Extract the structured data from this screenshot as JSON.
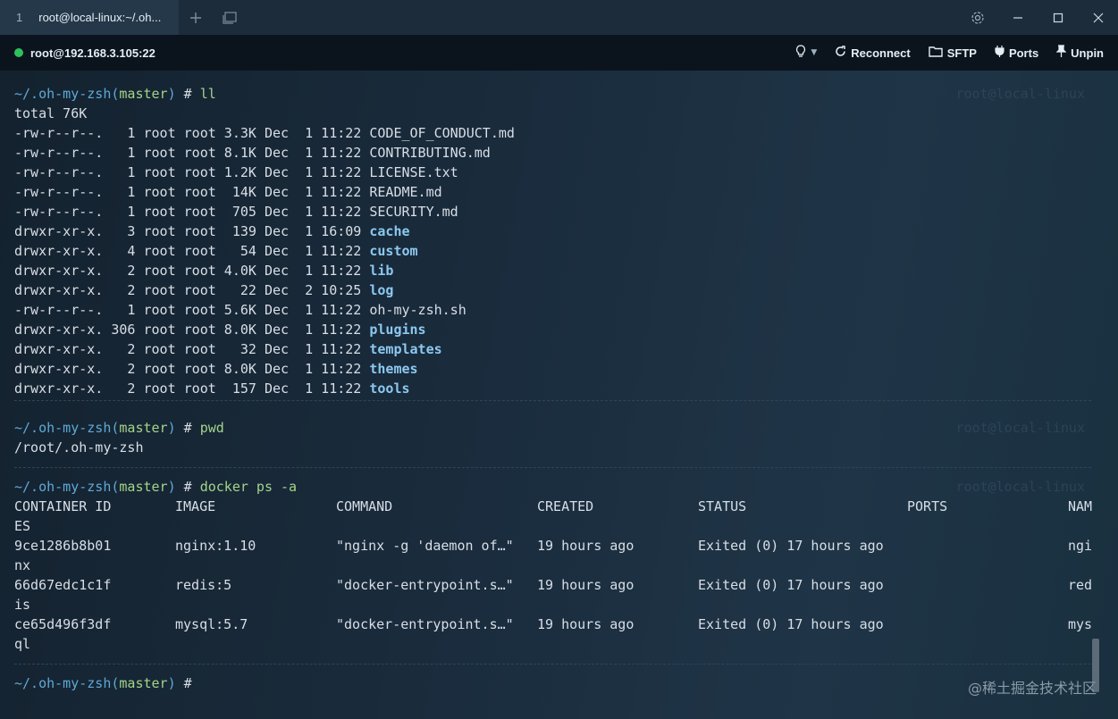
{
  "titlebar": {
    "tab_number": "1",
    "tab_title": "root@local-linux:~/.oh...",
    "new_tab_icon": "plus-icon",
    "tabs_icon": "windows-icon",
    "settings_icon": "gear-icon",
    "minimize_icon": "minimize-icon",
    "maximize_icon": "maximize-icon",
    "close_icon": "close-icon"
  },
  "session": {
    "status_color": "#2fbf5b",
    "host": "root@192.168.3.105:22",
    "hint_icon": "lightbulb-icon",
    "reconnect_label": "Reconnect",
    "sftp_label": "SFTP",
    "ports_label": "Ports",
    "unpin_label": "Unpin"
  },
  "terminal": {
    "host_marker": "root@local-linux",
    "prompt_path": "~/.oh-my-zsh",
    "prompt_branch_open": "(",
    "prompt_branch": "master",
    "prompt_branch_close": ")",
    "prompt_hash": " # ",
    "block1": {
      "command": "ll",
      "total": "total 76K",
      "rows": [
        {
          "meta": "-rw-r--r--.   1 root root 3.3K Dec  1 11:22 ",
          "name": "CODE_OF_CONDUCT.md",
          "dir": false
        },
        {
          "meta": "-rw-r--r--.   1 root root 8.1K Dec  1 11:22 ",
          "name": "CONTRIBUTING.md",
          "dir": false
        },
        {
          "meta": "-rw-r--r--.   1 root root 1.2K Dec  1 11:22 ",
          "name": "LICENSE.txt",
          "dir": false
        },
        {
          "meta": "-rw-r--r--.   1 root root  14K Dec  1 11:22 ",
          "name": "README.md",
          "dir": false
        },
        {
          "meta": "-rw-r--r--.   1 root root  705 Dec  1 11:22 ",
          "name": "SECURITY.md",
          "dir": false
        },
        {
          "meta": "drwxr-xr-x.   3 root root  139 Dec  1 16:09 ",
          "name": "cache",
          "dir": true
        },
        {
          "meta": "drwxr-xr-x.   4 root root   54 Dec  1 11:22 ",
          "name": "custom",
          "dir": true
        },
        {
          "meta": "drwxr-xr-x.   2 root root 4.0K Dec  1 11:22 ",
          "name": "lib",
          "dir": true
        },
        {
          "meta": "drwxr-xr-x.   2 root root   22 Dec  2 10:25 ",
          "name": "log",
          "dir": true
        },
        {
          "meta": "-rw-r--r--.   1 root root 5.6K Dec  1 11:22 ",
          "name": "oh-my-zsh.sh",
          "dir": false
        },
        {
          "meta": "drwxr-xr-x. 306 root root 8.0K Dec  1 11:22 ",
          "name": "plugins",
          "dir": true
        },
        {
          "meta": "drwxr-xr-x.   2 root root   32 Dec  1 11:22 ",
          "name": "templates",
          "dir": true
        },
        {
          "meta": "drwxr-xr-x.   2 root root 8.0K Dec  1 11:22 ",
          "name": "themes",
          "dir": true
        },
        {
          "meta": "drwxr-xr-x.   2 root root  157 Dec  1 11:22 ",
          "name": "tools",
          "dir": true
        }
      ]
    },
    "block2": {
      "command": "pwd",
      "output": "/root/.oh-my-zsh"
    },
    "block3": {
      "command": "docker ps -a",
      "headers": [
        "CONTAINER ID",
        "IMAGE",
        "COMMAND",
        "CREATED",
        "STATUS",
        "PORTS",
        "NAM"
      ],
      "header_wrap": "ES",
      "rows": [
        {
          "id": "9ce1286b8b01",
          "image": "nginx:1.10",
          "command": "\"nginx -g 'daemon of…\"",
          "created": "19 hours ago",
          "status": "Exited (0) 17 hours ago",
          "ports": "",
          "name": "ngi",
          "name_wrap": "nx"
        },
        {
          "id": "66d67edc1c1f",
          "image": "redis:5",
          "command": "\"docker-entrypoint.s…\"",
          "created": "19 hours ago",
          "status": "Exited (0) 17 hours ago",
          "ports": "",
          "name": "red",
          "name_wrap": "is"
        },
        {
          "id": "ce65d496f3df",
          "image": "mysql:5.7",
          "command": "\"docker-entrypoint.s…\"",
          "created": "19 hours ago",
          "status": "Exited (0) 17 hours ago",
          "ports": "",
          "name": "mys",
          "name_wrap": "ql"
        }
      ]
    }
  },
  "watermark": "@稀土掘金技术社区"
}
